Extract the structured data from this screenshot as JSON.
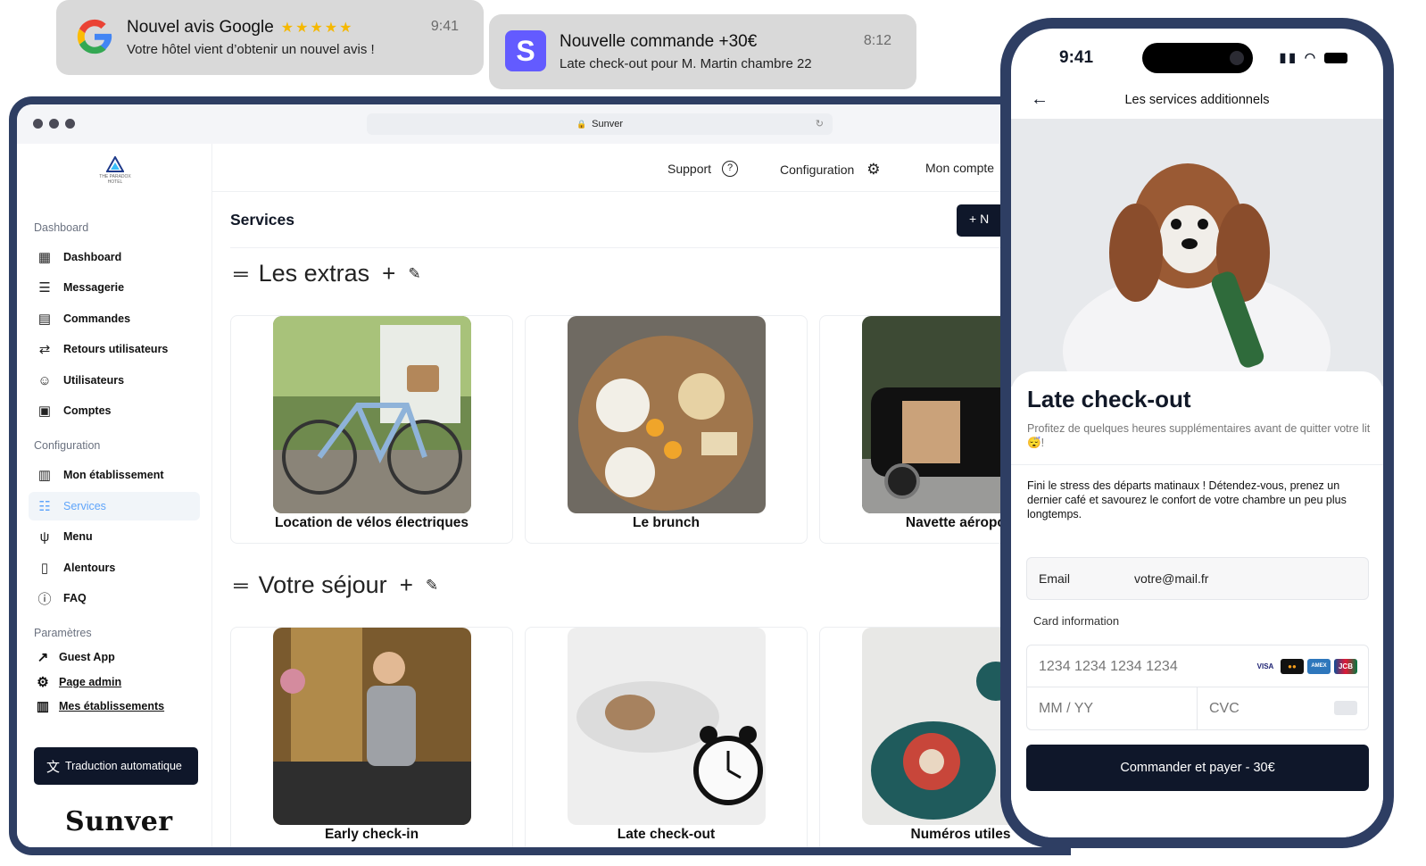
{
  "notifications": [
    {
      "title": "Nouvel avis Google",
      "body": "Votre hôtel vient d’obtenir un nouvel avis !",
      "time": "9:41",
      "stars": "★★★★★",
      "icon": "google-icon"
    },
    {
      "title": "Nouvelle commande +30€",
      "body": "Late check-out pour M. Martin chambre 22",
      "time": "8:12",
      "icon": "stripe-icon",
      "icon_letter": "S"
    }
  ],
  "browser": {
    "url": "Sunver"
  },
  "sidebar": {
    "logo_text": "THE PARADOX HOTEL",
    "section_dashboard": "Dashboard",
    "section_configuration": "Configuration",
    "section_parametres": "Paramètres",
    "dashboard_items": [
      {
        "label": "Dashboard",
        "icon": "dashboard-icon"
      },
      {
        "label": "Messagerie",
        "icon": "message-icon"
      },
      {
        "label": "Commandes",
        "icon": "orders-icon"
      },
      {
        "label": "Retours utilisateurs",
        "icon": "feedback-icon"
      },
      {
        "label": "Utilisateurs",
        "icon": "users-icon"
      },
      {
        "label": "Comptes",
        "icon": "accounts-icon"
      }
    ],
    "config_items": [
      {
        "label": "Mon établissement",
        "icon": "building-icon"
      },
      {
        "label": "Services",
        "icon": "list-icon",
        "active": true
      },
      {
        "label": "Menu",
        "icon": "fork-knife-icon"
      },
      {
        "label": "Alentours",
        "icon": "map-icon"
      },
      {
        "label": "FAQ",
        "icon": "help-icon"
      }
    ],
    "param_items": [
      {
        "label": "Guest App",
        "icon": "external-link-icon"
      },
      {
        "label": "Page admin",
        "icon": "admin-icon"
      },
      {
        "label": "Mes établissements",
        "icon": "buildings-icon"
      }
    ],
    "translate_label": "Traduction automatique",
    "brand": "Sunver"
  },
  "topnav": {
    "support": "Support",
    "configuration": "Configuration",
    "account": "Mon compte"
  },
  "main": {
    "title": "Services",
    "new_button": "+ N",
    "categories": [
      {
        "title": "Les extras",
        "cards": [
          "Location de vélos électriques",
          "Le brunch",
          "Navette aéroport"
        ]
      },
      {
        "title": "Votre séjour",
        "cards": [
          "Early check-in",
          "Late check-out",
          "Numéros utiles"
        ]
      }
    ]
  },
  "phone": {
    "time": "9:41",
    "header": "Les services additionnels",
    "title": "Late check-out",
    "subtitle": "Profitez de quelques heures supplémentaires avant de quitter votre lit 😴!",
    "description": "Fini le stress des départs matinaux ! Détendez-vous, prenez un dernier café et savourez le confort de votre chambre un peu plus longtemps.",
    "email_label": "Email",
    "email_value": "votre@mail.fr",
    "card_info_label": "Card information",
    "card_number_placeholder": "1234 1234 1234 1234",
    "expiry_placeholder": "MM / YY",
    "cvc_placeholder": "CVC",
    "card_brands": [
      "VISA",
      "MC",
      "AMEX",
      "JCB"
    ],
    "pay_button": "Commander et payer - 30€"
  },
  "colors": {
    "navy": "#2e3e63",
    "dark": "#0f172a",
    "accent": "#60a5fa",
    "notif_bg": "#d9d9d9",
    "star": "#f5b800"
  }
}
